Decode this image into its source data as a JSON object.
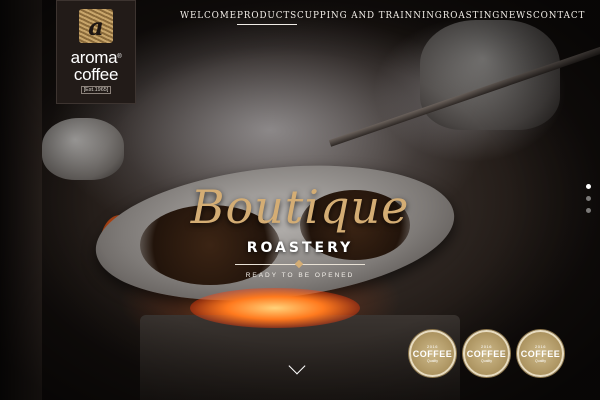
{
  "brand": {
    "logo_mark": "a",
    "line1": "aroma",
    "trademark": "®",
    "line2": "coffee",
    "est": "[Est.1965]"
  },
  "nav": {
    "items": [
      {
        "label": "WELCOME",
        "active": false
      },
      {
        "label": "PRODUCTS",
        "active": true
      },
      {
        "label": "CUPPING AND TRAINNING",
        "active": false
      },
      {
        "label": "ROASTING",
        "active": false
      },
      {
        "label": "NEWS",
        "active": false
      },
      {
        "label": "CONTACT",
        "active": false
      }
    ]
  },
  "hero": {
    "title": "Boutique",
    "subtitle": "ROASTERY",
    "tagline": "READY TO BE OPENED"
  },
  "slider": {
    "count": 3,
    "active_index": 0
  },
  "badges": [
    {
      "year": "2016",
      "word": "COFFEE",
      "sub": "Quality"
    },
    {
      "year": "2016",
      "word": "COFFEE",
      "sub": "Quality"
    },
    {
      "year": "2016",
      "word": "COFFEE",
      "sub": "Quality"
    }
  ],
  "icons": {
    "scroll": "chevron-down-icon"
  }
}
